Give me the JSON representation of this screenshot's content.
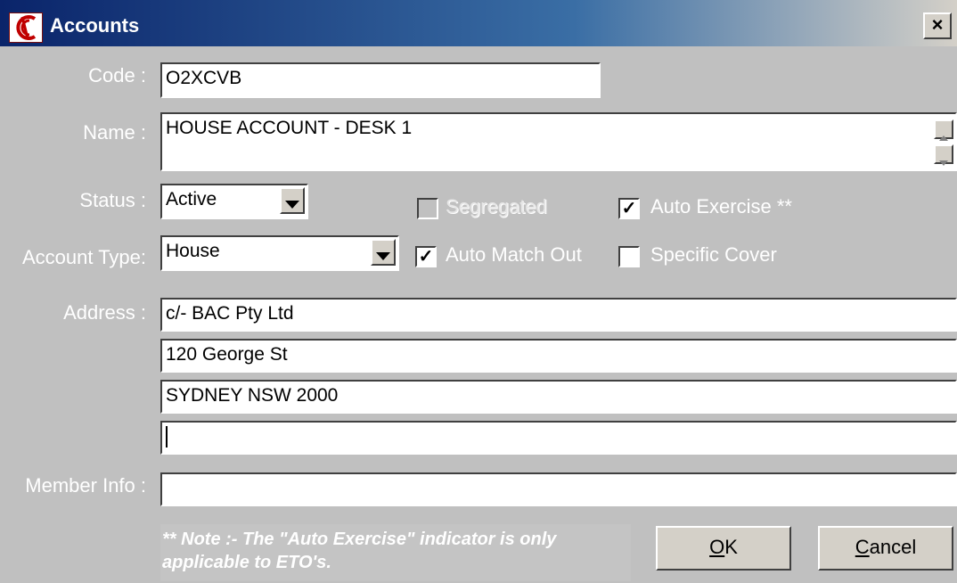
{
  "window": {
    "title": "Accounts",
    "close_symbol": "×"
  },
  "labels": {
    "code": "Code :",
    "name": "Name :",
    "status": "Status :",
    "account_type": "Account Type:",
    "address": "Address :",
    "member_info": "Member Info :"
  },
  "fields": {
    "code": "O2XCVB",
    "name": "HOUSE ACCOUNT - DESK 1",
    "status": "Active",
    "account_type": "House",
    "address": [
      "c/- BAC Pty Ltd",
      "120 George St",
      "SYDNEY NSW 2000",
      ""
    ],
    "member_info": ""
  },
  "checkboxes": {
    "segregated": {
      "label": "Segregated",
      "checked": false,
      "enabled": false
    },
    "auto_exercise": {
      "label": "Auto Exercise **",
      "checked": true,
      "enabled": true
    },
    "auto_match_out": {
      "label": "Auto Match Out",
      "checked": true,
      "enabled": true
    },
    "specific_cover": {
      "label": "Specific Cover",
      "checked": false,
      "enabled": true
    }
  },
  "note": "** Note :- The \"Auto Exercise\" indicator is only applicable to ETO's.",
  "buttons": {
    "ok": {
      "mnemonic": "O",
      "rest": "K"
    },
    "cancel": {
      "mnemonic": "C",
      "rest": "ancel"
    }
  },
  "icons": {
    "app": "accounts-app-icon",
    "close": "close-icon",
    "dropdown": "chevron-down-icon",
    "scroll_up": "scroll-up-icon",
    "scroll_down": "scroll-down-icon",
    "check": "checkmark-icon"
  },
  "colors": {
    "title_gradient_start": "#0a246a",
    "window_bg": "#c0c0c0",
    "label_text": "#ffffff"
  }
}
